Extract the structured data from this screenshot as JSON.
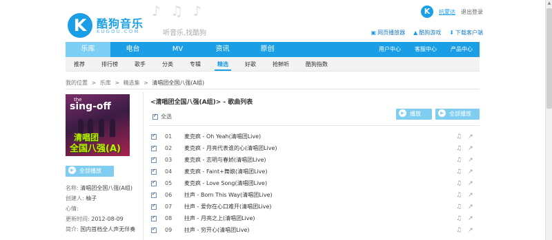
{
  "header": {
    "logo_letter": "K",
    "brand": "酷狗音乐",
    "brand_sub": "KUGOU.COM",
    "deco": "♪ ♫ ♪",
    "slogan": "听音乐,找酷狗",
    "user_icon_letter": "K",
    "username": "抗蒙达",
    "logout": "退出登录",
    "quick_links": [
      {
        "icon": "▣",
        "label": "网页播放器"
      },
      {
        "icon": "▲",
        "label": "酷狗游戏"
      },
      {
        "icon": "⬇",
        "label": "下载客户端"
      }
    ]
  },
  "mainnav": {
    "items": [
      "乐库",
      "电台",
      "MV",
      "资讯",
      "原创"
    ],
    "right": [
      "用户中心",
      "客服中心",
      "产品中心"
    ]
  },
  "subnav": {
    "items": [
      "推荐",
      "排行榜",
      "歌手",
      "分类",
      "专辑",
      "精选",
      "好歌",
      "抢鲜听",
      "酷狗指数"
    ]
  },
  "breadcrumb": {
    "label": "我的位置",
    "sep": ">",
    "items": [
      "乐库",
      "精选集"
    ],
    "current": "清唱团全国八强(A组)"
  },
  "cover": {
    "top_small": "the",
    "top_big": "sing-off",
    "mark1": "清唱团",
    "mark2": "全国八强(A)"
  },
  "left_play_all": "全部播放",
  "info": {
    "name_label": "名称:",
    "name": "清唱团全国八强(A组)",
    "creator_label": "创建人:",
    "creator": "柚子",
    "mood_label": "心情:",
    "mood": "",
    "updated_label": "更新时间:",
    "updated": "2012-08-09",
    "intro_label": "简介:",
    "intro": "国内首档全人声无伴奏"
  },
  "list": {
    "title": "<清唱团全国八强(A组)> - 歌曲列表",
    "select_all": "全选",
    "play_label": "播放",
    "play_all_label": "全部播放",
    "songs": [
      {
        "num": "01",
        "title": "麦克疯 - Oh Yeah(清唱团Live)"
      },
      {
        "num": "02",
        "title": "麦克疯 - 月亮代表谁的心(清唱团Live)"
      },
      {
        "num": "03",
        "title": "麦克疯 - 志明与春娇(清唱团Live)"
      },
      {
        "num": "04",
        "title": "麦克疯 - Faint+舞娘(清唱团Live)"
      },
      {
        "num": "05",
        "title": "麦克疯 - Love Song(清唱团Live)"
      },
      {
        "num": "06",
        "title": "拄声 - Born This Way(清唱团Live)"
      },
      {
        "num": "07",
        "title": "拄声 - 爱你在心口难开(清唱团Live)"
      },
      {
        "num": "08",
        "title": "拄声 - 月亮之上(清唱团Live)"
      },
      {
        "num": "09",
        "title": "拄声 - 穷开心(清唱团Live)"
      }
    ],
    "op_icons": [
      "♫",
      "↗"
    ]
  }
}
